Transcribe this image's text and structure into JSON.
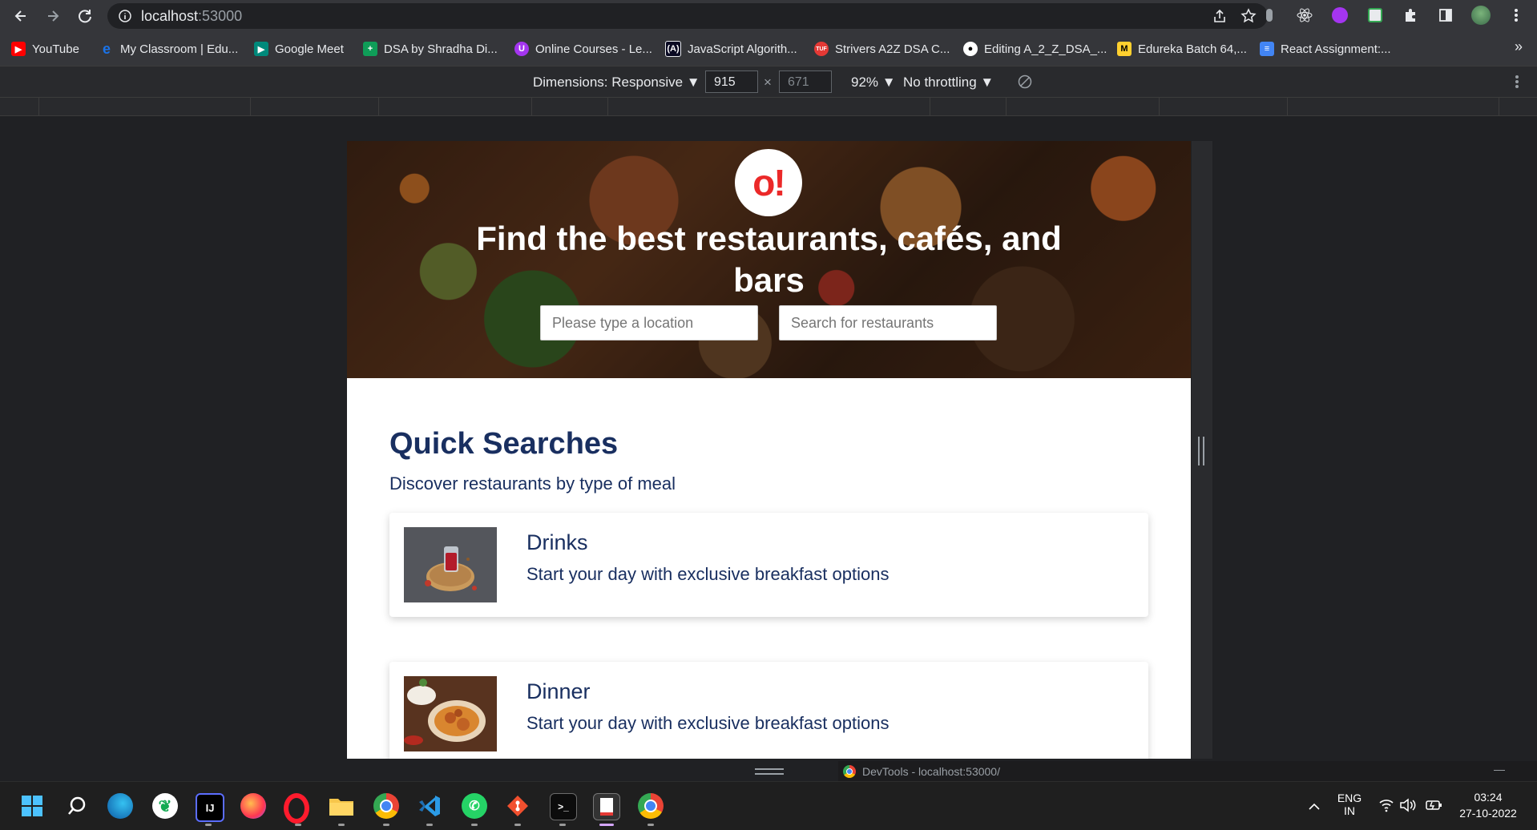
{
  "browser": {
    "url_host": "localhost",
    "url_port": ":53000",
    "bookmarks": [
      {
        "label": "YouTube",
        "icon": "youtube-icon",
        "color": "#ff0000"
      },
      {
        "label": "My Classroom | Edu...",
        "icon": "edureka-icon",
        "color": "#1a73e8"
      },
      {
        "label": "Google Meet",
        "icon": "google-meet-icon",
        "color": "#00897b"
      },
      {
        "label": "DSA by Shradha Di...",
        "icon": "sheets-plus-icon",
        "color": "#0f9d58"
      },
      {
        "label": "Online Courses - Le...",
        "icon": "udemy-icon",
        "color": "#a435f0"
      },
      {
        "label": "JavaScript Algorith...",
        "icon": "freecodecamp-icon",
        "color": "#0a0a23"
      },
      {
        "label": "Strivers A2Z DSA C...",
        "icon": "takeuforward-icon",
        "color": "#e53935"
      },
      {
        "label": "Editing A_2_Z_DSA_...",
        "icon": "github-icon",
        "color": "#ffffff"
      },
      {
        "label": "Edureka Batch 64,...",
        "icon": "miro-icon",
        "color": "#ffd02f"
      },
      {
        "label": "React Assignment:...",
        "icon": "google-docs-icon",
        "color": "#4285f4"
      }
    ],
    "more_bookmarks": "»"
  },
  "devtools": {
    "dimensions_label": "Dimensions: Responsive ▼",
    "width": "915",
    "times": "×",
    "height": "671",
    "zoom": "92% ▼",
    "throttling": "No throttling ▼",
    "window_title": "DevTools - localhost:53000/",
    "minimize": "—"
  },
  "app": {
    "logo": "o!",
    "hero_title": "Find the best restaurants, cafés, and bars",
    "location_placeholder": "Please type a location",
    "search_placeholder": "Search for restaurants",
    "quick_searches_title": "Quick Searches",
    "quick_searches_subtitle": "Discover restaurants by type of meal",
    "cards": [
      {
        "title": "Drinks",
        "description": "Start your day with exclusive breakfast options"
      },
      {
        "title": "Dinner",
        "description": "Start your day with exclusive breakfast options"
      }
    ]
  },
  "taskbar": {
    "language_top": "ENG",
    "language_bottom": "IN",
    "time": "03:24",
    "date": "27-10-2022"
  }
}
